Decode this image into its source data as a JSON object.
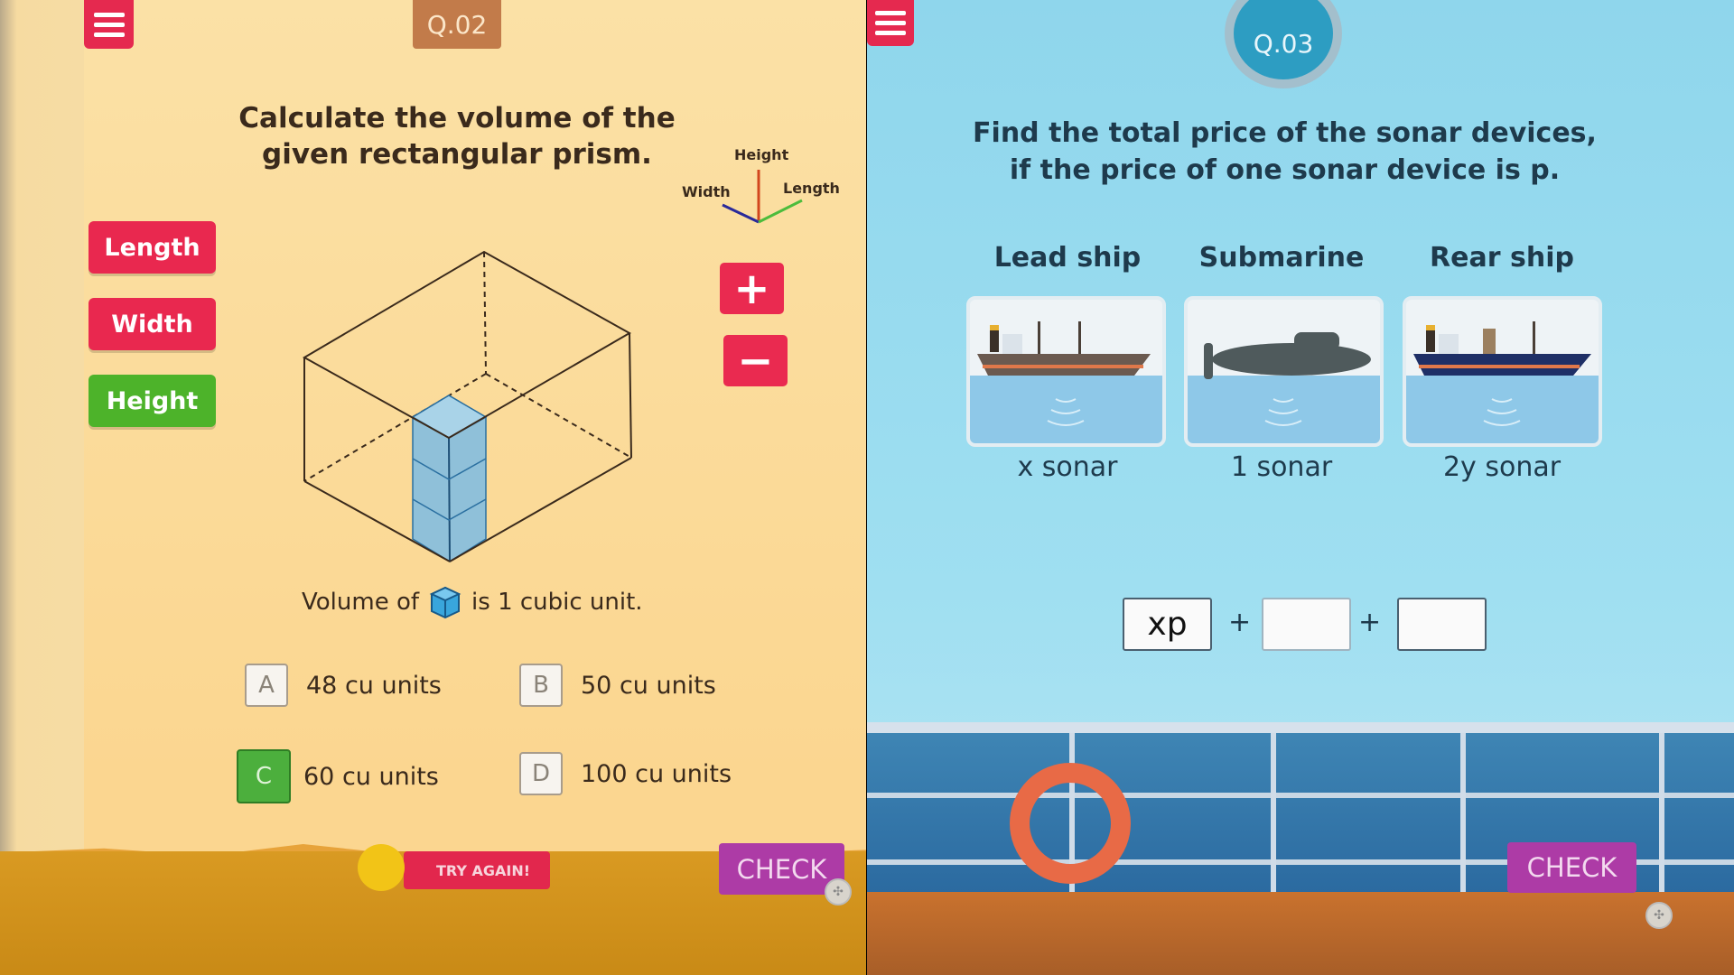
{
  "left_panel": {
    "question_number": "Q.02",
    "question": [
      "Calculate the volume of the",
      "given rectangular prism."
    ],
    "axis_legend": {
      "height": "Height",
      "width": "Width",
      "length": "Length"
    },
    "dimension_buttons": [
      {
        "label": "Length",
        "color": "#e9284f"
      },
      {
        "label": "Width",
        "color": "#e9284f"
      },
      {
        "label": "Height",
        "color": "#4db32a"
      }
    ],
    "zoom_buttons": {
      "plus": "+",
      "minus": "−"
    },
    "unit_note": {
      "before": "Volume of",
      "after": "is 1 cubic unit."
    },
    "options": [
      {
        "letter": "A",
        "text": "48 cu units",
        "selected": false
      },
      {
        "letter": "B",
        "text": "50 cu units",
        "selected": false
      },
      {
        "letter": "C",
        "text": "60 cu units",
        "selected": true
      },
      {
        "letter": "D",
        "text": "100 cu units",
        "selected": false
      }
    ],
    "feedback": "TRY AGAIN!",
    "check_label": "CHECK"
  },
  "right_panel": {
    "question_number": "Q.03",
    "question": [
      "Find the total price of the sonar devices,",
      "if the price of one sonar device is p."
    ],
    "vessels": [
      {
        "name": "Lead ship",
        "sonar": "x sonar",
        "hull": "#6b5a50"
      },
      {
        "name": "Submarine",
        "sonar": "1 sonar",
        "hull": "#4f5a5c"
      },
      {
        "name": "Rear ship",
        "sonar": "2y sonar",
        "hull": "#1e2f66"
      }
    ],
    "answer_inputs": [
      "xp",
      "",
      ""
    ],
    "operator": "+",
    "check_label": "CHECK"
  }
}
